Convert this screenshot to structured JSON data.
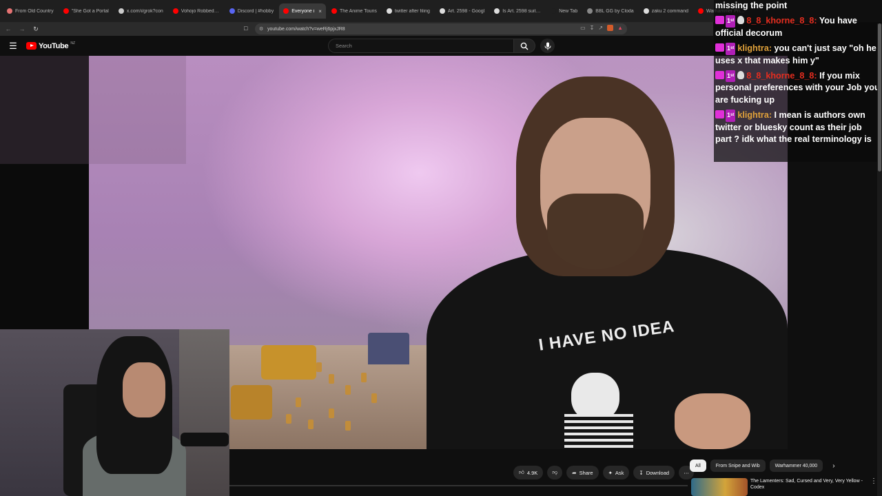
{
  "tabs": [
    {
      "label": "From Old Country",
      "color": "#e57373"
    },
    {
      "label": "\"She Got a Portal",
      "color": "#ff0000"
    },
    {
      "label": "x.com/i/grok?con",
      "color": "#cccccc"
    },
    {
      "label": "Vohojo Robbed, Ea",
      "color": "#ff0000"
    },
    {
      "label": "Discord | #hobby",
      "color": "#5865f2"
    },
    {
      "label": "Everyone i",
      "color": "#ff0000"
    },
    {
      "label": "The Anime Touris",
      "color": "#ff0000"
    },
    {
      "label": "twitter after filing",
      "color": "#dddddd"
    },
    {
      "label": "Art. 2598 - Googl",
      "color": "#dddddd"
    },
    {
      "label": "Is Art. 2598 suitab",
      "color": "#dddddd"
    },
    {
      "label": "New Tab",
      "color": "#1f1f1f"
    },
    {
      "label": "BBL GG by Cloda",
      "color": "#888888"
    },
    {
      "label": "zaku 2 command",
      "color": "#dddddd"
    },
    {
      "label": "Warhammer Price",
      "color": "#ff0000"
    }
  ],
  "browser": {
    "url": "youtube.com/watch?v=weRj6pjxJR8"
  },
  "youtube": {
    "logo_text": "YouTube",
    "country_code": "NZ",
    "search_placeholder": "Search"
  },
  "chat": {
    "header_text": "missing the point",
    "messages": [
      {
        "user": "8_8_khorne_8_8",
        "user_color": "#e52d1f",
        "text": "You have official decorum",
        "skull": true
      },
      {
        "user": "klightra",
        "user_color": "#e0a13a",
        "text": "you can't just say \"oh he uses x that makes him y\"",
        "skull": false
      },
      {
        "user": "8_8_khorne_8_8",
        "user_color": "#e52d1f",
        "text": "If you mix personal preferences with your Job you are fucking up",
        "skull": true
      },
      {
        "user": "klightra",
        "user_color": "#e0a13a",
        "text": "I mean is authors own twitter or bluesky count as their job part ? idk what the real terminology is",
        "skull": false
      }
    ],
    "sub_badge": "1ˢᵗ"
  },
  "video": {
    "shirt_text": "I HAVE NO IDEA"
  },
  "actions": {
    "likes": "4.9K",
    "share": "Share",
    "ask": "Ask",
    "download": "Download"
  },
  "chips": [
    "All",
    "From Snipe and Wib",
    "Warhammer 40,000"
  ],
  "recommendation": {
    "title": "The Lamenters: Sad, Cursed and Very, Very Yellow - Codex"
  }
}
